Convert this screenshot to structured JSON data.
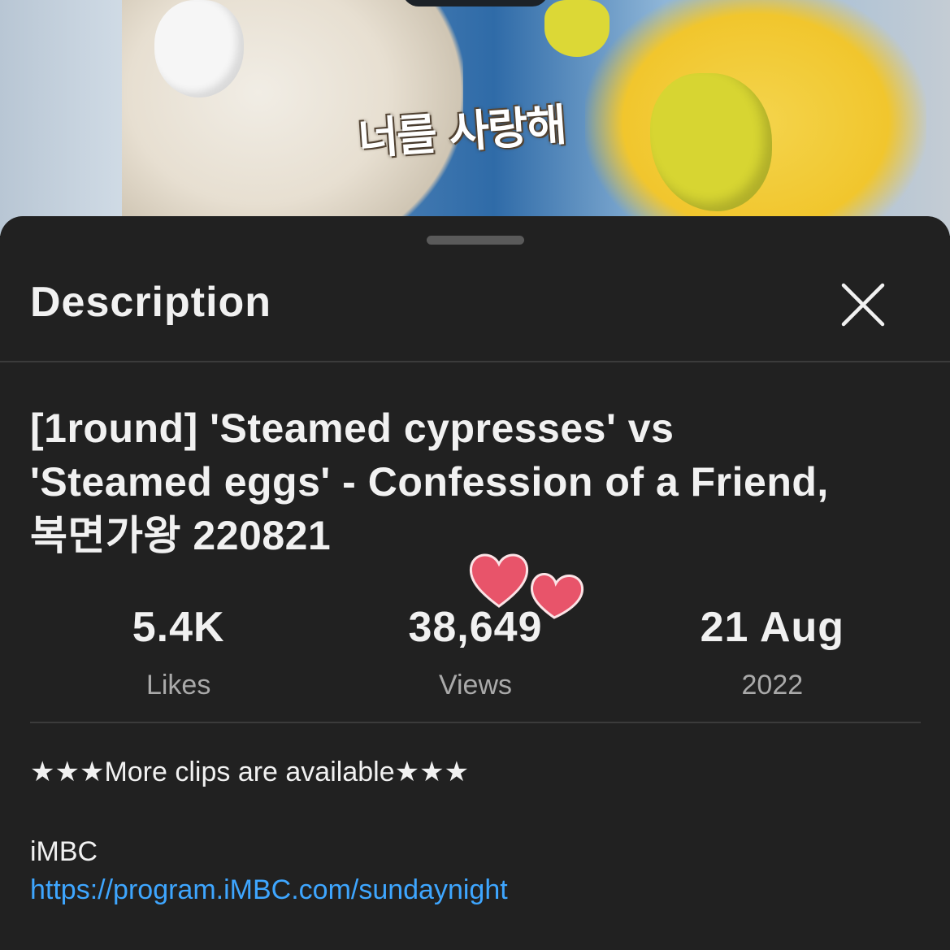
{
  "video_frame": {
    "caption": "너를 사랑해"
  },
  "sheet": {
    "title": "Description",
    "close_icon": "close-icon"
  },
  "video": {
    "title_line1": "[1round] 'Steamed cypresses' vs",
    "title_line2": "'Steamed eggs' - Confession of a Friend,",
    "title_line3": "복면가왕 220821"
  },
  "stats": [
    {
      "value": "5.4K",
      "label": "Likes"
    },
    {
      "value": "38,649",
      "label": "Views"
    },
    {
      "value": "21 Aug",
      "label": "2022"
    }
  ],
  "description": {
    "line1": "★★★More clips are available★★★",
    "line2": "iMBC",
    "link": "https://program.iMBC.com/sundaynight"
  },
  "colors": {
    "background": "#212121",
    "text": "#f1f1f1",
    "muted": "#aaaaaa",
    "link": "#3ea6ff",
    "heart": "#e8546a"
  }
}
